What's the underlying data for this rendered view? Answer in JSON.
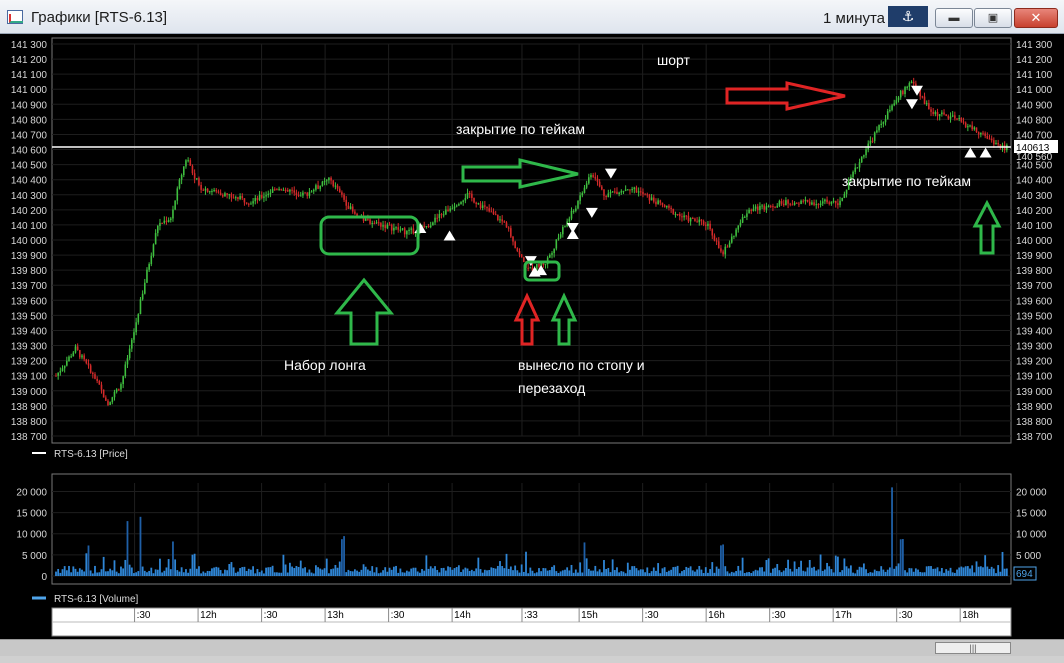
{
  "window": {
    "title": "Графики [RTS-6.13]",
    "timeframe": "1 минута",
    "anchor_icon": "anchor-icon",
    "minimize_label": "▬",
    "maximize_label": "▣",
    "close_label": "✕"
  },
  "colors": {
    "background": "#000000",
    "up_candle": "#3fbf3f",
    "down_candle": "#d42a2a",
    "volume": "#2f86d6",
    "price_line": "#ffffff",
    "annotation_green": "#2fb84a",
    "annotation_red": "#e02424"
  },
  "price_panel": {
    "legend": "RTS-6.13 [Price]",
    "current_price_label": "140613",
    "secondary_price_label": "140 560",
    "y_ticks": [
      "141 300",
      "141 200",
      "141 100",
      "141 000",
      "140 900",
      "140 800",
      "140 700",
      "140 600",
      "140 500",
      "140 400",
      "140 300",
      "140 200",
      "140 100",
      "140 000",
      "139 900",
      "139 800",
      "139 700",
      "139 600",
      "139 500",
      "139 400",
      "139 300",
      "139 200",
      "139 100",
      "139 000",
      "138 900",
      "138 800",
      "138 700"
    ],
    "annotations": {
      "short": "шорт",
      "take_close_1": "закрытие по тейкам",
      "take_close_2": "закрытие по тейкам",
      "long_entry": "Набор лонга",
      "stopped_out_1": "вынесло по стопу и",
      "stopped_out_2": "перезаход"
    }
  },
  "volume_panel": {
    "legend": "RTS-6.13 [Volume]",
    "current_volume_label": "694",
    "y_ticks": [
      "20 000",
      "15 000",
      "10 000",
      "5 000",
      "0"
    ]
  },
  "time_axis": {
    "ticks": [
      ":30",
      "12h",
      ":30",
      "13h",
      ":30",
      "14h",
      ":33",
      "15h",
      ":30",
      "16h",
      ":30",
      "17h",
      ":30",
      "18h"
    ]
  },
  "chart_data": {
    "type": "candlestick",
    "instrument": "RTS-6.13",
    "timeframe": "1 минута",
    "ylim": [
      138700,
      141300
    ],
    "volume_ylim": [
      0,
      22000
    ],
    "price_path": [
      [
        11.0,
        139100
      ],
      [
        11.15,
        139280
      ],
      [
        11.25,
        139150
      ],
      [
        11.4,
        138920
      ],
      [
        11.5,
        139050
      ],
      [
        11.6,
        139400
      ],
      [
        11.7,
        139800
      ],
      [
        11.78,
        140100
      ],
      [
        11.88,
        140150
      ],
      [
        11.95,
        140400
      ],
      [
        12.0,
        140550
      ],
      [
        12.1,
        140350
      ],
      [
        12.3,
        140300
      ],
      [
        12.5,
        140250
      ],
      [
        12.7,
        140350
      ],
      [
        12.9,
        140300
      ],
      [
        13.1,
        140400
      ],
      [
        13.3,
        140150
      ],
      [
        13.5,
        140100
      ],
      [
        13.7,
        140050
      ],
      [
        13.85,
        140100
      ],
      [
        14.0,
        140200
      ],
      [
        14.15,
        140300
      ],
      [
        14.3,
        140200
      ],
      [
        14.45,
        140100
      ],
      [
        14.55,
        139900
      ],
      [
        14.62,
        139800
      ],
      [
        14.75,
        139850
      ],
      [
        14.9,
        140100
      ],
      [
        15.0,
        140250
      ],
      [
        15.1,
        140450
      ],
      [
        15.2,
        140300
      ],
      [
        15.4,
        140350
      ],
      [
        15.6,
        140250
      ],
      [
        15.8,
        140150
      ],
      [
        16.0,
        140100
      ],
      [
        16.1,
        139900
      ],
      [
        16.3,
        140200
      ],
      [
        16.6,
        140250
      ],
      [
        16.9,
        140250
      ],
      [
        17.0,
        140250
      ],
      [
        17.2,
        140600
      ],
      [
        17.45,
        140950
      ],
      [
        17.55,
        141050
      ],
      [
        17.7,
        140850
      ],
      [
        17.9,
        140800
      ],
      [
        18.1,
        140700
      ],
      [
        18.25,
        140613
      ]
    ],
    "volume_peaks": [
      [
        11.25,
        8000
      ],
      [
        11.55,
        13000
      ],
      [
        11.65,
        14500
      ],
      [
        11.9,
        8500
      ],
      [
        12.05,
        5500
      ],
      [
        13.2,
        9500
      ],
      [
        14.45,
        5800
      ],
      [
        15.05,
        8500
      ],
      [
        16.1,
        7500
      ],
      [
        16.45,
        4200
      ],
      [
        17.4,
        21000
      ],
      [
        17.48,
        9000
      ],
      [
        18.25,
        6000
      ]
    ]
  }
}
